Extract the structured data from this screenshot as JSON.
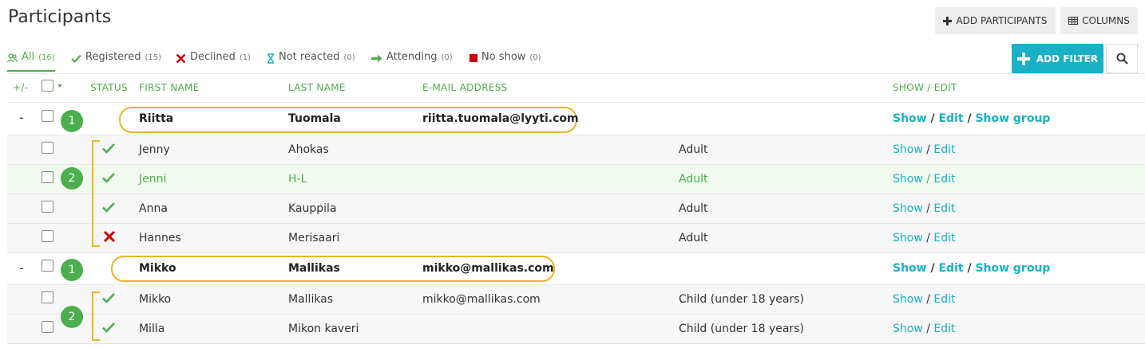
{
  "page": {
    "title": "Participants"
  },
  "toolbar": {
    "add_participants_label": "ADD PARTICIPANTS",
    "columns_label": "COLUMNS",
    "add_filter_label": "ADD FILTER"
  },
  "tabs": [
    {
      "label": "All",
      "count": "(16)",
      "icon": "group-icon",
      "active": true
    },
    {
      "label": "Registered",
      "count": "(15)",
      "icon": "check-icon"
    },
    {
      "label": "Declined",
      "count": "(1)",
      "icon": "x-icon"
    },
    {
      "label": "Not reacted",
      "count": "(0)",
      "icon": "hourglass-icon"
    },
    {
      "label": "Attending",
      "count": "(0)",
      "icon": "arrow-right-icon"
    },
    {
      "label": "No show",
      "count": "(0)",
      "icon": "square-icon"
    }
  ],
  "table": {
    "headers": {
      "expand": "+/-",
      "status": "STATUS",
      "first_name": "FIRST NAME",
      "last_name": "LAST NAME",
      "email": "E-MAIL ADDRESS",
      "show_edit": "SHOW / EDIT"
    },
    "link_labels": {
      "show": "Show",
      "slash": "/",
      "edit": "Edit",
      "show_group": "Show group"
    },
    "collapse_symbol": "-",
    "badges": {
      "primary": "1",
      "members": "2"
    },
    "groups": [
      {
        "leader": {
          "first": "Riitta",
          "last": "Tuomala",
          "email": "riitta.tuomala@lyyti.com"
        },
        "members": [
          {
            "first": "Jenny",
            "last": "Ahokas",
            "email": "",
            "category": "Adult",
            "status": "registered"
          },
          {
            "first": "Jenni",
            "last": "H-L",
            "email": "",
            "category": "Adult",
            "status": "registered"
          },
          {
            "first": "Anna",
            "last": "Kauppila",
            "email": "",
            "category": "Adult",
            "status": "registered"
          },
          {
            "first": "Hannes",
            "last": "Merisaari",
            "email": "",
            "category": "Adult",
            "status": "declined"
          }
        ]
      },
      {
        "leader": {
          "first": "Mikko",
          "last": "Mallikas",
          "email": "mikko@mallikas.com"
        },
        "members": [
          {
            "first": "Mikko",
            "last": "Mallikas",
            "email": "mikko@mallikas.com",
            "category": "Child (under 18 years)",
            "status": "registered"
          },
          {
            "first": "Milla",
            "last": "Mikon kaveri",
            "email": "",
            "category": "Child (under 18 years)",
            "status": "registered"
          }
        ]
      }
    ]
  },
  "colors": {
    "accent_green": "#4cae4c",
    "link_blue": "#1ab0c6",
    "annotation_orange": "#f0b323",
    "declined_red": "#cc0000"
  }
}
